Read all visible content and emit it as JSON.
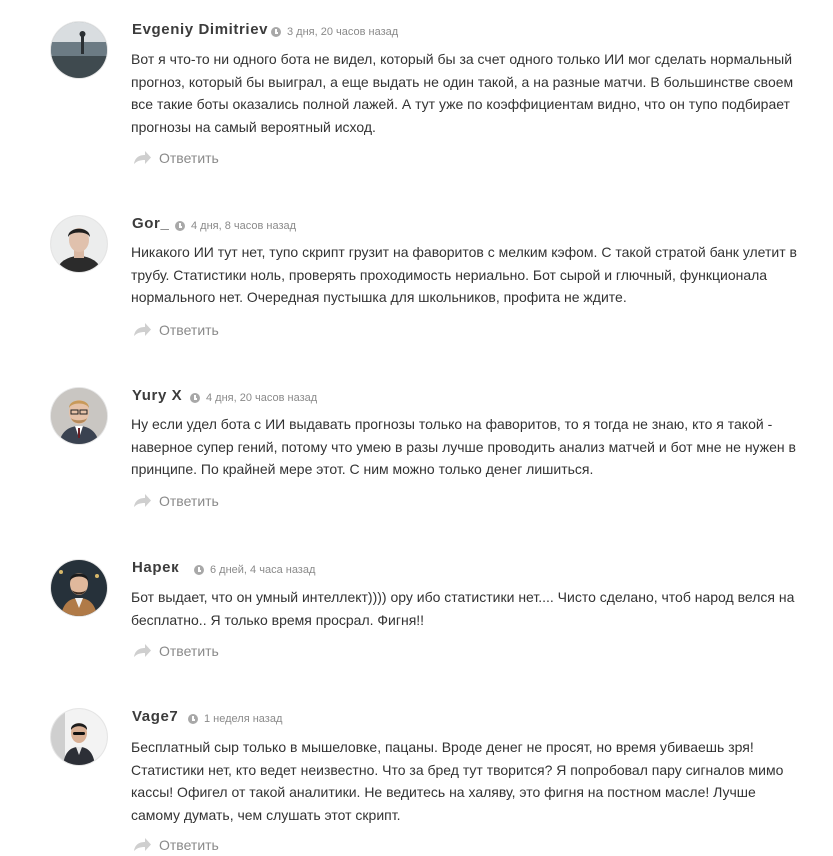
{
  "comments": [
    {
      "author": "Evgeniy Dimitriev",
      "time": "3 дня, 20 часов назад",
      "text": "Вот я что-то ни одного бота не видел, который бы за счет одного только ИИ мог сделать нормальный прогноз, который бы выиграл, а еще выдать не один такой, а на разные матчи. В большинстве своем все такие боты оказались полной лажей. А тут уже по коэффициентам видно, что он тупо подбирает прогнозы на самый вероятный исход.",
      "reply": "Ответить"
    },
    {
      "author": "Gor_",
      "time": "4 дня, 8 часов назад",
      "text": "Никакого ИИ тут нет, тупо скрипт грузит на фаворитов с мелким кэфом. С такой стратой банк улетит в трубу. Статистики ноль, проверять проходимость нериально. Бот сырой и глючный, функционала нормального нет. Очередная пустышка для школьников, профита не ждите.",
      "reply": "Ответить"
    },
    {
      "author": "Yury X",
      "time": "4 дня, 20 часов назад",
      "text": "Ну если удел бота с ИИ выдавать прогнозы только на фаворитов, то я тогда не знаю, кто я такой - наверное супер гений, потому что умею в разы лучше проводить анализ матчей и бот мне не нужен в принципе. По крайней мере этот. С ним можно только денег лишиться.",
      "reply": "Ответить"
    },
    {
      "author": "Нарек",
      "time": "6 дней, 4 часа назад",
      "text": "Бот выдает, что он умный интеллект)))) ору ибо статистики нет.... Чисто сделано, чтоб народ велся на бесплатно.. Я только время просрал. Фигня!!",
      "reply": "Ответить"
    },
    {
      "author": "Vage7",
      "time": "1 неделя назад",
      "text": "Бесплатный сыр только в мышеловке, пацаны. Вроде денег не просят, но время убиваешь зря! Статистики нет, кто ведет неизвестно. Что за бред тут творится? Я попробовал пару сигналов мимо кассы! Офигел от такой аналитики. Не ведитесь на халяву, это фигня на постном масле! Лучше самому думать, чем слушать этот скрипт.",
      "reply": "Ответить"
    }
  ],
  "colors": {
    "author": "#3c3c3c",
    "meta": "#8a8a8a",
    "text": "#333333",
    "reply_icon": "#cfcfcf"
  }
}
